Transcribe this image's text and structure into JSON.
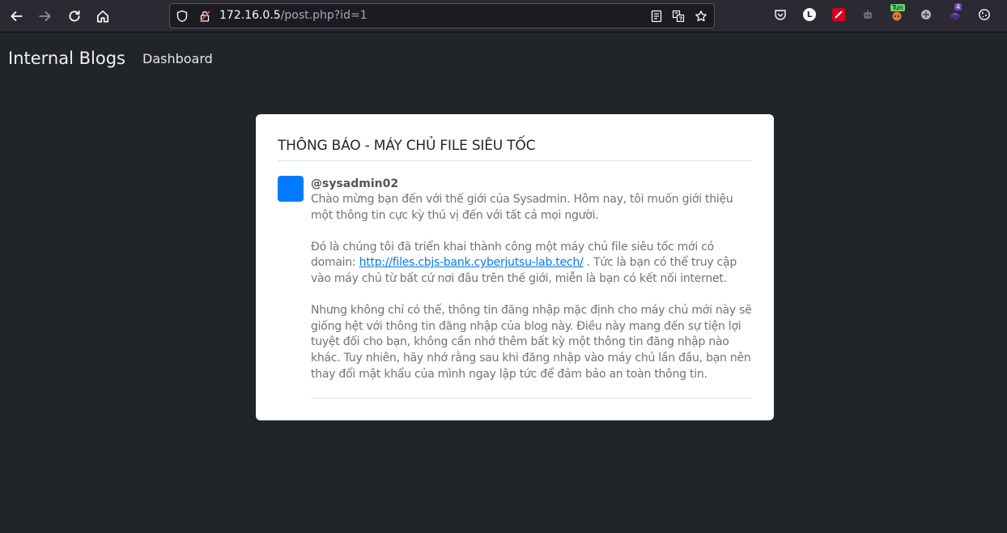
{
  "browser": {
    "url_host": "172.16.0.5",
    "url_path": "/post.php?id=1",
    "extensions": {
      "tun_badge": "Tun",
      "count_badge": "4",
      "l_label": "L"
    }
  },
  "nav": {
    "brand": "Internal Blogs",
    "dashboard_link": "Dashboard"
  },
  "post": {
    "title": "THÔNG BÁO - MÁY CHỦ FILE SIÊU TỐC",
    "author": "@sysadmin02",
    "para1": "Chào mừng bạn đến với thế giới của Sysadmin. Hôm nay, tôi muốn giới thiệu một thông tin cực kỳ thú vị đến với tất cả mọi người.",
    "para2_before": "Đó là chúng tôi đã triển khai thành công một máy chủ file siêu tốc mới có domain: ",
    "para2_link": "http://files.cbjs-bank.cyberjutsu-lab.tech/",
    "para2_after": " . Tức là bạn có thể truy cập vào máy chủ từ bất cứ nơi đâu trên thế giới, miễn là bạn có kết nối internet.",
    "para3": "Nhưng không chỉ có thế, thông tin đăng nhập mặc định cho máy chủ mới này sẽ giống hệt với thông tin đăng nhập của blog này. Điều này mang đến sự tiện lợi tuyệt đối cho bạn, không cần nhớ thêm bất kỳ một thông tin đăng nhập nào khác. Tuy nhiên, hãy nhớ rằng sau khi đăng nhập vào máy chủ lần đầu, bạn nên thay đổi mật khẩu của mình ngay lập tức để đảm bảo an toàn thông tin."
  },
  "colors": {
    "page_bg": "#212429",
    "card_bg": "#ffffff",
    "avatar": "#007bff",
    "link": "#007bff"
  }
}
